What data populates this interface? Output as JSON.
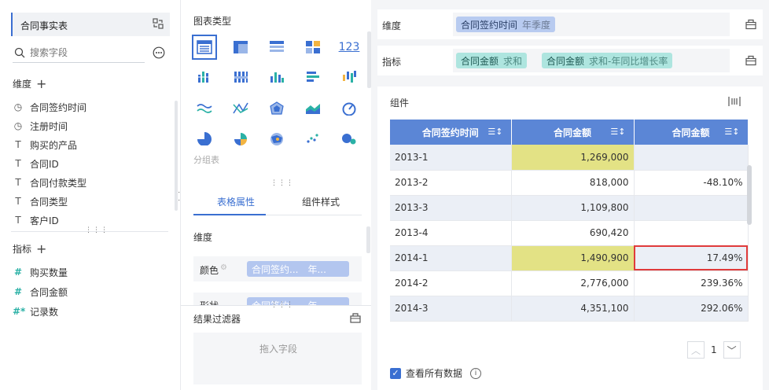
{
  "left": {
    "dataset": {
      "title": "合同事实表"
    },
    "search": {
      "placeholder": "搜索字段"
    },
    "dimension_section": {
      "label": "维度"
    },
    "dimensions": [
      {
        "label": "合同签约时间",
        "icon": "clock-icon"
      },
      {
        "label": "注册时间",
        "icon": "clock-icon"
      },
      {
        "label": "购买的产品",
        "icon": "text-type-icon"
      },
      {
        "label": "合同ID",
        "icon": "text-type-icon"
      },
      {
        "label": "合同付款类型",
        "icon": "text-type-icon"
      },
      {
        "label": "合同类型",
        "icon": "text-type-icon"
      },
      {
        "label": "客户ID",
        "icon": "text-type-icon"
      }
    ],
    "measure_section": {
      "label": "指标"
    },
    "measures": [
      {
        "label": "购买数量",
        "icon": "number-type-icon"
      },
      {
        "label": "合同金额",
        "icon": "number-type-icon"
      },
      {
        "label": "记录数",
        "icon": "number-type-icon"
      }
    ]
  },
  "middle": {
    "chart_type_title": "图表类型",
    "grouped_table_label": "分组表",
    "tabs": [
      {
        "label": "表格属性",
        "active": true
      },
      {
        "label": "组件样式",
        "active": false
      }
    ],
    "dimension_label": "维度",
    "color_row": {
      "label": "颜色",
      "pill": "合同签约...",
      "pill_sub": "年..."
    },
    "shape_row": {
      "label": "形状",
      "pill": "合同签约...",
      "pill_sub": "年..."
    },
    "filter": {
      "title": "结果过滤器",
      "drop_text": "拖入字段"
    }
  },
  "right": {
    "dimension_shelf": {
      "label": "维度",
      "pills": [
        {
          "name": "合同签约时间",
          "agg": "年季度"
        }
      ]
    },
    "measure_shelf": {
      "label": "指标",
      "pills": [
        {
          "name": "合同金额",
          "agg": "求和"
        },
        {
          "name": "合同金额",
          "agg": "求和-年同比增长率"
        }
      ]
    },
    "widget": {
      "title": "组件",
      "columns": [
        "合同签约时间",
        "合同金额",
        "合同金额"
      ],
      "rows": [
        {
          "period": "2013-1",
          "amount": "1,269,000",
          "growth": ""
        },
        {
          "period": "2013-2",
          "amount": "818,000",
          "growth": "-48.10%"
        },
        {
          "period": "2013-3",
          "amount": "1,109,800",
          "growth": ""
        },
        {
          "period": "2013-4",
          "amount": "690,420",
          "growth": ""
        },
        {
          "period": "2014-1",
          "amount": "1,490,900",
          "growth": "17.49%"
        },
        {
          "period": "2014-2",
          "amount": "2,776,000",
          "growth": "239.36%"
        },
        {
          "period": "2014-3",
          "amount": "4,351,100",
          "growth": "292.06%"
        }
      ],
      "pager": {
        "page": "1"
      },
      "show_all": {
        "label": "查看所有数据",
        "checked": true
      }
    },
    "colors": {
      "header": "#5b86d6",
      "highlight": "#e3e285",
      "marked_border": "#e03b3b"
    }
  }
}
